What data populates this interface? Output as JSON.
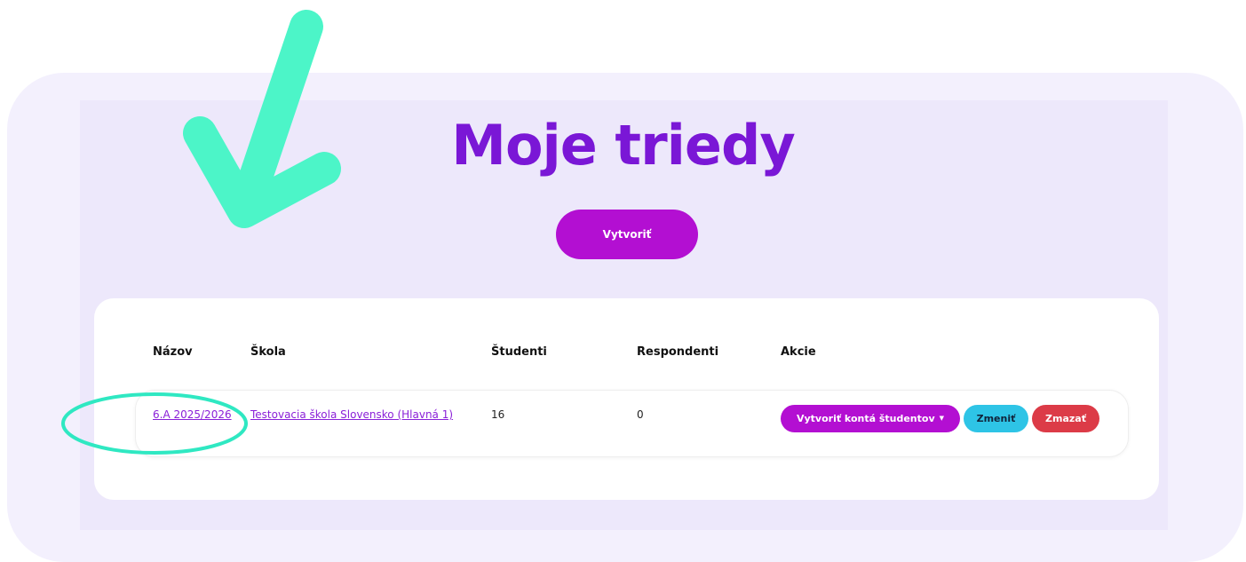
{
  "page": {
    "title": "Moje triedy",
    "create_button_label": "Vytvoriť"
  },
  "table": {
    "headers": [
      "Názov",
      "Škola",
      "Študenti",
      "Respondenti",
      "Akcie"
    ],
    "rows": [
      {
        "name": "6.A 2025/2026",
        "school": "Testovacia škola Slovensko (Hlavná 1)",
        "students": "16",
        "respondents": "0",
        "actions": {
          "create_accounts": "Vytvoriť kontá študentov",
          "edit": "Zmeniť",
          "delete": "Zmazať"
        }
      }
    ]
  },
  "colors": {
    "accent_purple": "#b30fd2",
    "title_purple": "#7a17d6",
    "edit_cyan": "#2ec4e6",
    "delete_red": "#dc3b47",
    "annotation_mint": "#4cf5c8"
  },
  "icons": {
    "dropdown_caret": "caret-down-icon",
    "annotation_check": "checkmark-icon",
    "annotation_circle": "highlight-ellipse"
  }
}
